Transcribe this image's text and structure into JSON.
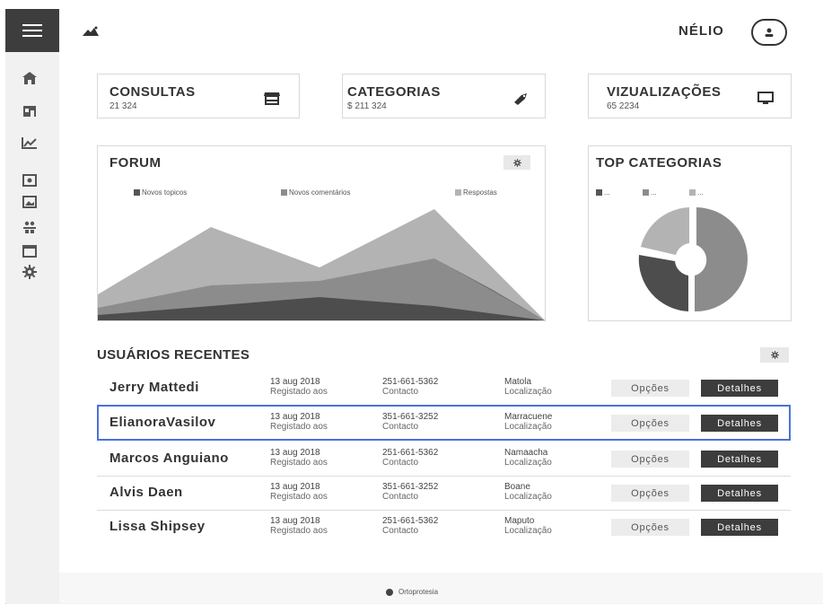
{
  "header": {
    "logo_icon": "mountain-logo-icon",
    "user_name": "NÉLIO",
    "avatar_icon": "user-icon"
  },
  "sidebar": {
    "menu_icon": "hamburger-icon",
    "items": [
      {
        "icon": "home-icon"
      },
      {
        "icon": "shop-icon"
      },
      {
        "icon": "line-chart-icon"
      },
      {
        "icon": "money-icon"
      },
      {
        "icon": "image-icon"
      },
      {
        "icon": "people-icon"
      },
      {
        "icon": "calendar-icon"
      },
      {
        "icon": "gear-icon"
      }
    ]
  },
  "stats": [
    {
      "title": "CONSULTAS",
      "value": "21 324",
      "icon": "store-icon"
    },
    {
      "title": "CATEGORIAS",
      "value": "$ 211 324",
      "icon": "tag-icon"
    },
    {
      "title": "VIZUALIZAÇÕES",
      "value": "65 2234",
      "icon": "monitor-icon"
    }
  ],
  "forum": {
    "title": "FORUM",
    "legend": [
      "Novos topicos",
      "Novos comentários",
      "Respostas"
    ]
  },
  "top_categories": {
    "title": "TOP CATEGORIAS",
    "legend": [
      "...",
      "...",
      "..."
    ]
  },
  "users": {
    "title": "USUÁRIOS RECENTES",
    "rows": [
      {
        "name": "Jerry Mattedi",
        "date": "13 aug 2018",
        "date_label": "Registado aos",
        "phone": "251-661-5362",
        "phone_label": "Contacto",
        "location": "Matola",
        "location_label": "Localização",
        "options": "Opções",
        "details": "Detalhes"
      },
      {
        "name": "ElianoraVasilov",
        "date": "13 aug 2018",
        "date_label": "Registado aos",
        "phone": "351-661-3252",
        "phone_label": "Contacto",
        "location": "Marracuene",
        "location_label": "Localização",
        "options": "Opções",
        "details": "Detalhes"
      },
      {
        "name": "Marcos Anguiano",
        "date": "13 aug 2018",
        "date_label": "Registado aos",
        "phone": "251-661-5362",
        "phone_label": "Contacto",
        "location": "Namaacha",
        "location_label": "Localização",
        "options": "Opções",
        "details": "Detalhes"
      },
      {
        "name": "Alvis Daen",
        "date": "13 aug 2018",
        "date_label": "Registado aos",
        "phone": "351-661-3252",
        "phone_label": "Contacto",
        "location": "Boane",
        "location_label": "Localização",
        "options": "Opções",
        "details": "Detalhes"
      },
      {
        "name": "Lissa Shipsey",
        "date": "13 aug 2018",
        "date_label": "Registado aos",
        "phone": "251-661-5362",
        "phone_label": "Contacto",
        "location": "Maputo",
        "location_label": "Localização",
        "options": "Opções",
        "details": "Detalhes"
      }
    ]
  },
  "footer": {
    "text": "Ortoprotesia"
  },
  "colors": {
    "dark": "#3d3d3d",
    "selection": "#4a72d8",
    "area_light": "#b3b3b3",
    "area_mid": "#8c8c8c",
    "area_dark": "#4d4d4d"
  }
}
